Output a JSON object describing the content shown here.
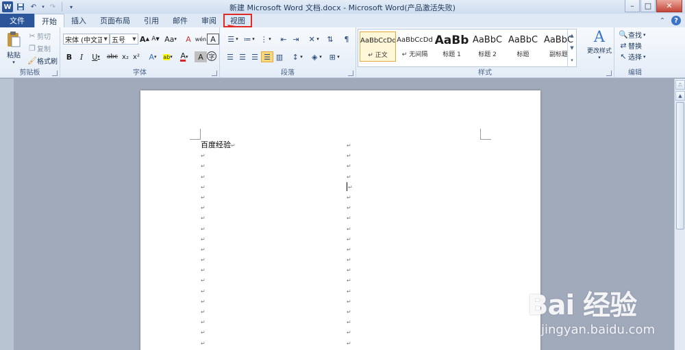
{
  "window": {
    "title": "新建 Microsoft Word 文档.docx - Microsoft Word(产品激活失败)",
    "app_icon": "W",
    "controls": {
      "minimize": "–",
      "maximize": "□",
      "close": "✕"
    }
  },
  "quick_access": {
    "icons": [
      "word-logo",
      "save-icon",
      "undo-icon",
      "redo-icon",
      "customize-icon"
    ]
  },
  "tabs": [
    {
      "label": "文件",
      "kind": "file"
    },
    {
      "label": "开始",
      "kind": "active"
    },
    {
      "label": "插入",
      "kind": "normal"
    },
    {
      "label": "页面布局",
      "kind": "normal"
    },
    {
      "label": "引用",
      "kind": "normal"
    },
    {
      "label": "邮件",
      "kind": "normal"
    },
    {
      "label": "审阅",
      "kind": "normal"
    },
    {
      "label": "视图",
      "kind": "highlight"
    }
  ],
  "ribbon": {
    "clipboard": {
      "label": "剪贴板",
      "paste": "粘贴",
      "cut": "剪切",
      "copy": "复制",
      "format_painter": "格式刷"
    },
    "font": {
      "label": "字体",
      "font_name": "宋体 (中文正文",
      "font_size": "五号",
      "bold": "B",
      "italic": "I",
      "underline": "U",
      "strike": "abc",
      "subscript": "x₂",
      "superscript": "x²",
      "grow": "A",
      "shrink": "A",
      "change_case": "Aa",
      "clear_format": "A",
      "text_effect": "A",
      "highlight": "ab",
      "font_color": "A",
      "char_shading": "A",
      "encircle": "字",
      "phonetic": "wén",
      "char_border": "A"
    },
    "paragraph": {
      "label": "段落"
    },
    "styles": {
      "label": "样式",
      "items": [
        {
          "sample": "AaBbCcDd",
          "name": "↵ 正文",
          "selected": true
        },
        {
          "sample": "AaBbCcDd",
          "name": "↵ 无间隔",
          "selected": false
        },
        {
          "sample": "AaBb",
          "name": "标题 1",
          "selected": false
        },
        {
          "sample": "AaBbC",
          "name": "标题 2",
          "selected": false
        },
        {
          "sample": "AaBbC",
          "name": "标题",
          "selected": false
        },
        {
          "sample": "AaBbC",
          "name": "副标题",
          "selected": false
        }
      ],
      "change_styles": "更改样式"
    },
    "editing": {
      "label": "编辑",
      "find": "查找",
      "replace": "替换",
      "select": "选择"
    }
  },
  "document": {
    "first_line": "百度经验",
    "paragraph_mark": "↵",
    "rows": 20
  },
  "watermark": {
    "logo": "Bai 经验",
    "url": "jingyan.baidu.com"
  }
}
